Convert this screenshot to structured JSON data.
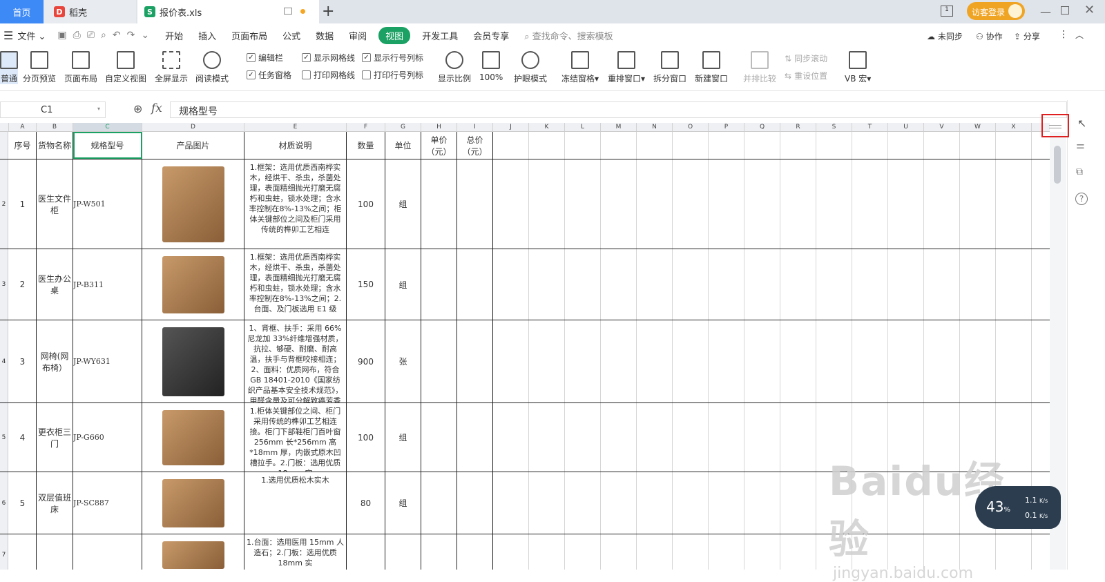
{
  "tabs": {
    "home": "首页",
    "daoke": "稻壳",
    "file": "报价表.xls"
  },
  "titlebar": {
    "login": "访客登录"
  },
  "menu": {
    "file": "文件",
    "items": [
      "开始",
      "插入",
      "页面布局",
      "公式",
      "数据",
      "审阅",
      "视图",
      "开发工具",
      "会员专享"
    ],
    "search_placeholder": "查找命令、搜索模板",
    "sync": "未同步",
    "collab": "协作",
    "share": "分享"
  },
  "ribbon": {
    "buttons": [
      "普通",
      "分页预览",
      "页面布局",
      "自定义视图",
      "全屏显示",
      "阅读模式"
    ],
    "checks": [
      {
        "label": "编辑栏",
        "checked": true
      },
      {
        "label": "显示网格线",
        "checked": true
      },
      {
        "label": "显示行号列标",
        "checked": true
      },
      {
        "label": "任务窗格",
        "checked": true
      },
      {
        "label": "打印网格线",
        "checked": false
      },
      {
        "label": "打印行号列标",
        "checked": false
      }
    ],
    "buttons2": [
      "显示比例",
      "100%",
      "护眼模式",
      "冻结窗格",
      "重排窗口",
      "拆分窗口",
      "新建窗口",
      "并排比较"
    ],
    "sync_scroll": "同步滚动",
    "reset_pos": "重设位置",
    "vb": "VB 宏"
  },
  "formula_bar": {
    "cell": "C1",
    "value": "规格型号"
  },
  "columns": [
    "A",
    "B",
    "C",
    "D",
    "E",
    "F",
    "G",
    "H",
    "I",
    "J",
    "K",
    "L",
    "M",
    "N",
    "O",
    "P",
    "Q",
    "R",
    "S",
    "T",
    "U",
    "V",
    "W",
    "X"
  ],
  "header_row": {
    "seq": "序号",
    "name": "货物名称",
    "model": "规格型号",
    "image": "产品图片",
    "material": "材质说明",
    "qty": "数量",
    "unit": "单位",
    "unit_price": "单价（元）",
    "total": "总价（元）"
  },
  "rows": [
    {
      "num": "2",
      "seq": "1",
      "name": "医生文件柜",
      "model": "JP-W501",
      "material": "1.框架：选用优质西南桦实木，经烘干、杀虫，杀菌处理，表面精细抛光打磨无腐朽和虫蛀，锁水处理；含水率控制在8%-13%之间；柜体关键部位之间及柜门采用传统的榫卯工艺相连",
      "qty": "100",
      "unit": "组"
    },
    {
      "num": "3",
      "seq": "2",
      "name": "医生办公桌",
      "model": "JP-B311",
      "material": "1.框架：选用优质西南桦实木，经烘干、杀虫，杀菌处理，表面精细抛光打磨无腐朽和虫蛀，锁水处理；含水率控制在8%-13%之间；2.台面、及门板选用 E1 级",
      "qty": "150",
      "unit": "组"
    },
    {
      "num": "4",
      "seq": "3",
      "name": "网椅(网布椅）",
      "model": "JP-WY631",
      "material": "1、背框、扶手：采用 66%尼龙加 33%纤维增强材质，抗拉、够硬、耐磨、耐高温，扶手与背框咬接相连；2、面料：优质网布，符合 GB 18401-2010《国家纺织产品基本安全技术规范》，甲醛含量及可分解致癌芳香",
      "qty": "900",
      "unit": "张"
    },
    {
      "num": "5",
      "seq": "4",
      "name": "更衣柜三门",
      "model": "JP-G660",
      "material": "1.柜体关键部位之间、柜门采用传统的榫卯工艺相连接。柜门下部鞋柜门百叶窗256mm 长*256mm 高*18mm 厚，内嵌式原木凹槽拉手。2.门板：选用优质 18mm 实",
      "qty": "100",
      "unit": "组"
    },
    {
      "num": "6",
      "seq": "5",
      "name": "双层值班床",
      "model": "JP-SC887",
      "material": "1.选用优质松木实木",
      "qty": "80",
      "unit": "组"
    },
    {
      "num": "7",
      "seq": "",
      "name": "",
      "model": "",
      "material": "1.台面：选用医用 15mm 人造石；2.门板：选用优质 18mm 实",
      "qty": "",
      "unit": ""
    }
  ],
  "net": {
    "percent": "43",
    "up": "1.1",
    "down": "0.1",
    "unit": "K/s"
  },
  "watermark": {
    "brand": "Baidu经验",
    "url": "jingyan.baidu.com"
  }
}
